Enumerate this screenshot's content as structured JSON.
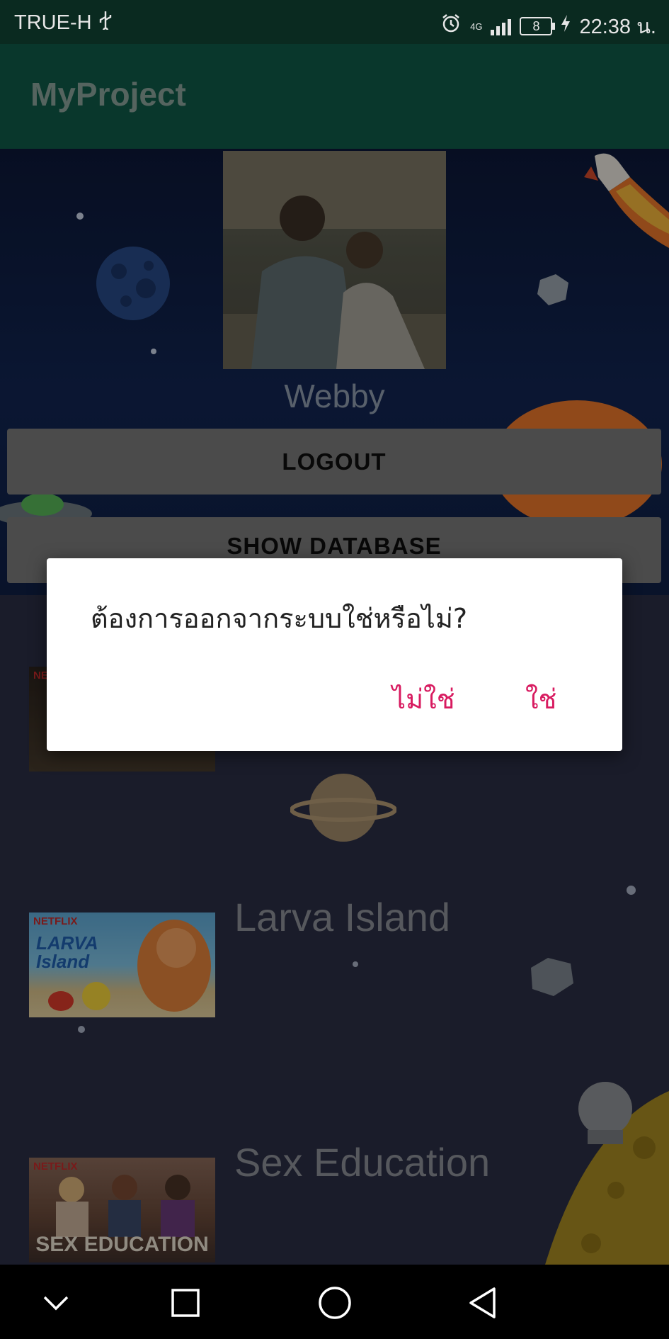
{
  "status_bar": {
    "carrier": "TRUE-H",
    "usb_icon": "usb-icon",
    "alarm_icon": "alarm-icon",
    "network_type": "4G",
    "battery_level": "8",
    "time": "22:38 น."
  },
  "app_bar": {
    "title": "MyProject"
  },
  "profile": {
    "name": "Webby"
  },
  "buttons": {
    "logout": "LOGOUT",
    "show_database": "SHOW DATABASE"
  },
  "list": {
    "items": [
      {
        "title": "Larva Island",
        "badge": "NETFLIX",
        "poster_text": "LARVA Island"
      },
      {
        "title": "Sex Education",
        "badge": "NETFLIX",
        "poster_text": "SEX EDUCATION"
      }
    ],
    "partial_badge": "NETFLIX"
  },
  "dialog": {
    "message": "ต้องการออกจากระบบใช่หรือไม่?",
    "negative": "ไม่ใช่",
    "positive": "ใช่",
    "accent_color": "#d81b60"
  },
  "nav_bar": {
    "icons": [
      "chevron-down-icon",
      "recents-square-icon",
      "home-circle-icon",
      "back-triangle-icon"
    ]
  },
  "colors": {
    "app_bar": "#0f5a47",
    "status_bar": "#0a2a20",
    "background": "#2b2e44"
  }
}
